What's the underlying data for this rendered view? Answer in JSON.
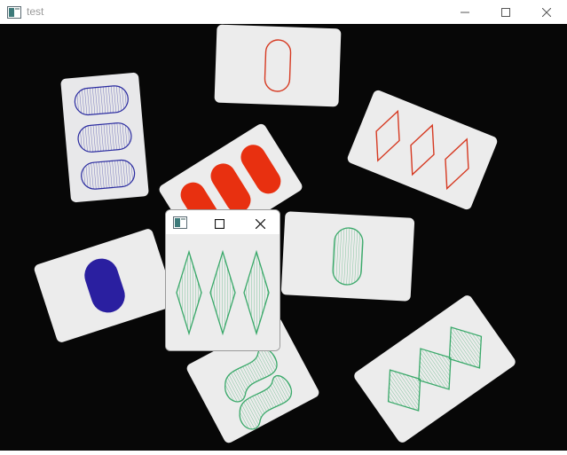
{
  "window": {
    "title": "test",
    "icon": "app-window-icon",
    "controls": [
      "minimize-icon",
      "maximize-icon",
      "close-icon"
    ]
  },
  "popup": {
    "icon": "app-window-icon",
    "controls": [
      "maximize-icon",
      "close-icon"
    ]
  },
  "cards": [
    {
      "count": 1,
      "shape": "oval",
      "fill": "empty",
      "color": "red"
    },
    {
      "count": 3,
      "shape": "oval",
      "fill": "striped",
      "color": "purple"
    },
    {
      "count": 3,
      "shape": "oval",
      "fill": "solid",
      "color": "red"
    },
    {
      "count": 3,
      "shape": "diamond",
      "fill": "empty",
      "color": "red"
    },
    {
      "count": 1,
      "shape": "oval",
      "fill": "solid",
      "color": "purple"
    },
    {
      "count": 1,
      "shape": "oval",
      "fill": "striped",
      "color": "green"
    },
    {
      "count": 2,
      "shape": "squiggle",
      "fill": "striped",
      "color": "green"
    },
    {
      "count": 3,
      "shape": "diamond",
      "fill": "striped",
      "color": "green"
    },
    {
      "count": 3,
      "shape": "diamond",
      "fill": "striped",
      "color": "green"
    }
  ],
  "colors": {
    "red": "#d63a22",
    "purple": "#2a2ba0",
    "green": "#3aa96a",
    "card": "#ececec",
    "table": "#070707"
  }
}
